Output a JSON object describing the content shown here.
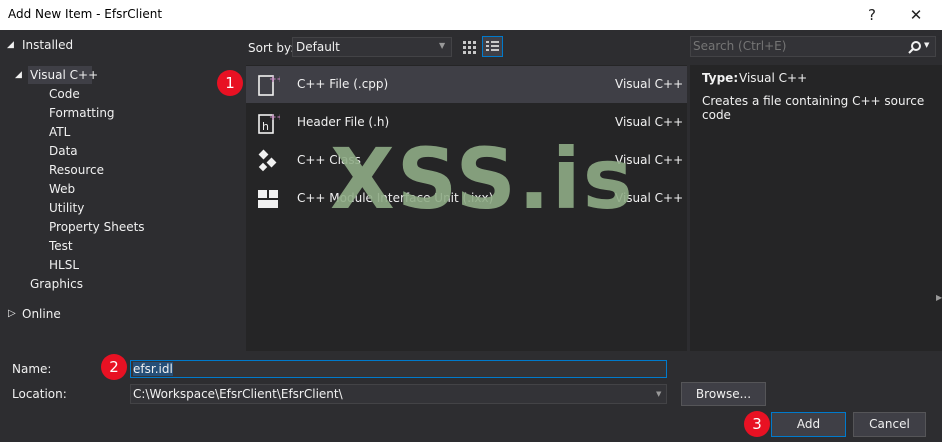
{
  "window": {
    "title": "Add New Item - EfsrClient",
    "help_glyph": "?",
    "close_glyph": "✕"
  },
  "tree": {
    "installed": "Installed",
    "visual_cpp": "Visual C++",
    "children": [
      "Code",
      "Formatting",
      "ATL",
      "Data",
      "Resource",
      "Web",
      "Utility",
      "Property Sheets",
      "Test",
      "HLSL"
    ],
    "graphics": "Graphics",
    "online": "Online"
  },
  "toolbar": {
    "sort_label": "Sort by:",
    "sort_value": "Default",
    "search_placeholder": "Search (Ctrl+E)"
  },
  "templates": [
    {
      "name": "C++ File (.cpp)",
      "lang": "Visual C++",
      "icon": "cpp-file-icon"
    },
    {
      "name": "Header File (.h)",
      "lang": "Visual C++",
      "icon": "header-file-icon"
    },
    {
      "name": "C++ Class",
      "lang": "Visual C++",
      "icon": "cpp-class-icon"
    },
    {
      "name": "C++ Module Interface Unit (.ixx)",
      "lang": "Visual C++",
      "icon": "module-unit-icon"
    }
  ],
  "details": {
    "type_label": "Type:",
    "type_value": "Visual C++",
    "description": "Creates a file containing C++ source code"
  },
  "form": {
    "name_label": "Name:",
    "name_value": "efsr.idl",
    "location_label": "Location:",
    "location_value": "C:\\Workspace\\EfsrClient\\EfsrClient\\",
    "browse_label": "Browse...",
    "add_label": "Add",
    "cancel_label": "Cancel"
  },
  "annotations": {
    "badge1": "1",
    "badge2": "2",
    "badge3": "3",
    "watermark": "XSS.is"
  },
  "colors": {
    "accent": "#007acc",
    "badge": "#e81123",
    "background": "#2d2d30",
    "panel": "#252526",
    "selected_row": "#3f3f46"
  }
}
